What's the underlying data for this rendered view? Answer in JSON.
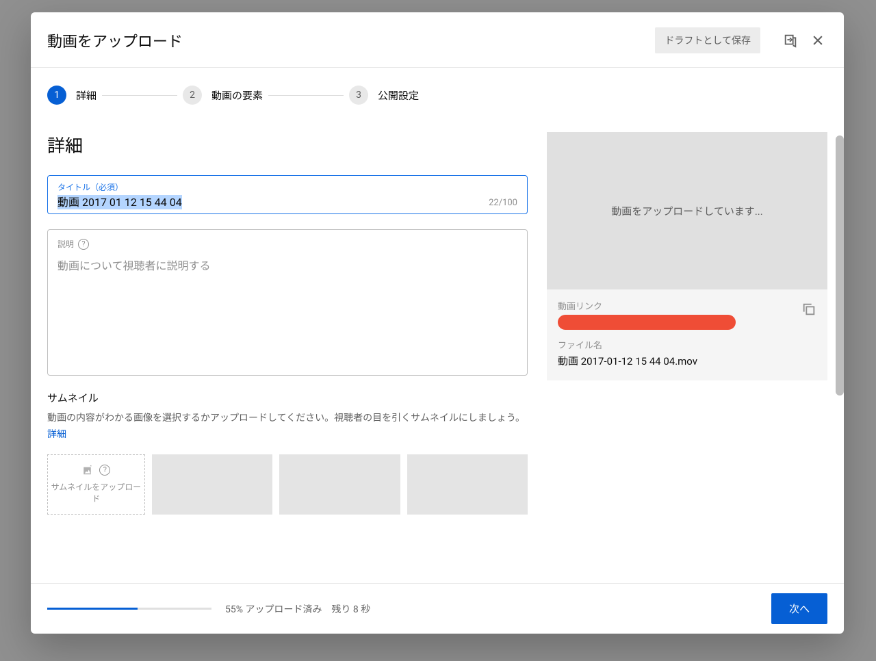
{
  "dialog": {
    "title": "動画をアップロード",
    "save_draft": "ドラフトとして保存"
  },
  "steps": [
    {
      "num": "1",
      "label": "詳細"
    },
    {
      "num": "2",
      "label": "動画の要素"
    },
    {
      "num": "3",
      "label": "公開設定"
    }
  ],
  "details": {
    "heading": "詳細",
    "title_field_label": "タイトル（必須）",
    "title_value": "動画 2017 01 12 15 44 04",
    "char_count": "22/100",
    "desc_label": "説明",
    "desc_placeholder": "動画について視聴者に説明する"
  },
  "thumbnails": {
    "heading": "サムネイル",
    "desc_prefix": "動画の内容がわかる画像を選択するかアップロードしてください。視聴者の目を引くサムネイルにしましょう。 ",
    "desc_link": "詳細",
    "upload_label": "サムネイルをアップロード"
  },
  "preview": {
    "uploading": "動画をアップロードしています...",
    "link_label": "動画リンク",
    "file_label": "ファイル名",
    "file_name": "動画 2017-01-12 15 44 04.mov"
  },
  "footer": {
    "progress_percent": 55,
    "progress_text": "55% アップロード済み　残り 8 秒",
    "next": "次へ"
  }
}
